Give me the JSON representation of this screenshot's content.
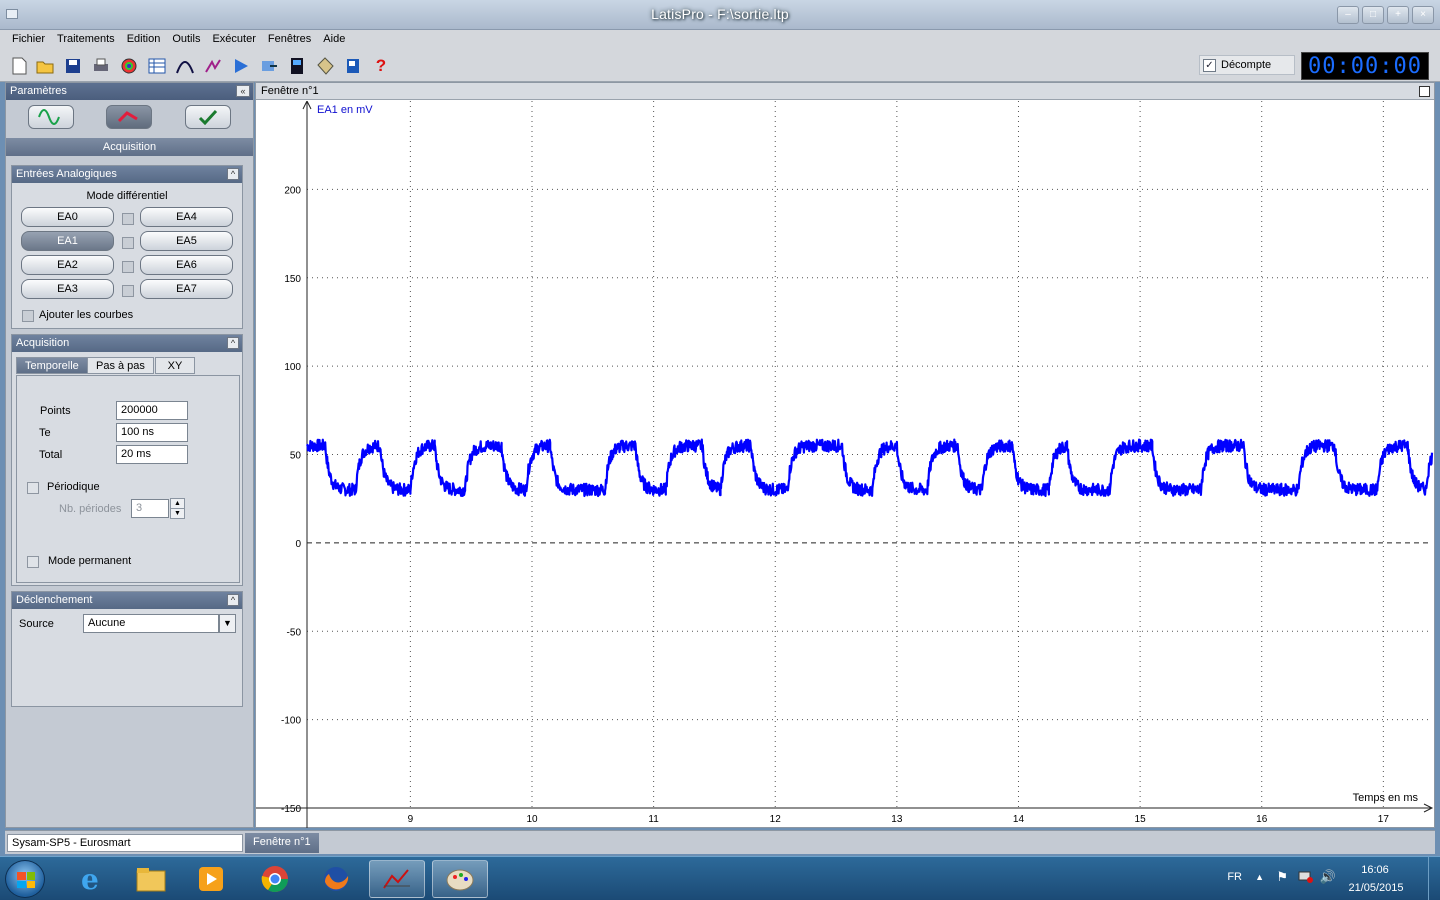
{
  "window": {
    "title": "LatisPro - F:\\sortie.ltp"
  },
  "menu": [
    "Fichier",
    "Traitements",
    "Edition",
    "Outils",
    "Exécuter",
    "Fenêtres",
    "Aide"
  ],
  "toolbar": {
    "icons": [
      "new-icon",
      "open-icon",
      "save-icon",
      "print-icon",
      "color-icon",
      "table-icon",
      "curve-icon",
      "modeling-icon",
      "play-icon",
      "export-icon",
      "device-icon",
      "tag-icon",
      "book-icon",
      "help-icon"
    ],
    "help_glyph": "?",
    "decompte_label": "Décompte",
    "decompte_checked": true,
    "timer": "00:00:00"
  },
  "params": {
    "header": "Paramètres",
    "collapse_glyph": "«",
    "section": "Acquisition",
    "entrees": {
      "title": "Entrées Analogiques",
      "mode": "Mode différentiel",
      "channels_left": [
        "EA0",
        "EA1",
        "EA2",
        "EA3"
      ],
      "channels_right": [
        "EA4",
        "EA5",
        "EA6",
        "EA7"
      ],
      "selected": "EA1",
      "add_curves": "Ajouter les courbes"
    },
    "acquisition": {
      "title": "Acquisition",
      "tabs": [
        "Temporelle",
        "Pas à pas",
        "XY"
      ],
      "points_label": "Points",
      "points_value": "200000",
      "te_label": "Te",
      "te_value": "100 ns",
      "total_label": "Total",
      "total_value": "20 ms",
      "periodique": "Périodique",
      "nb_periodes_label": "Nb. périodes",
      "nb_periodes_value": "3",
      "mode_permanent": "Mode permanent"
    },
    "declenchement": {
      "title": "Déclenchement",
      "source_label": "Source",
      "source_value": "Aucune"
    }
  },
  "graph": {
    "window_title": "Fenêtre n°1",
    "y_label": "EA1 en mV",
    "x_label": "Temps en ms"
  },
  "chart_data": {
    "type": "line",
    "series": [
      {
        "name": "EA1",
        "color": "#0000ff"
      }
    ],
    "x_range": [
      8.15,
      17.4
    ],
    "y_range": [
      -150,
      250
    ],
    "x_ticks": [
      9,
      10,
      11,
      12,
      13,
      14,
      15,
      16,
      17
    ],
    "y_ticks": [
      200,
      150,
      100,
      50,
      0,
      -50,
      -100,
      -150
    ],
    "signal": {
      "description_of_shape": "square-like wave alternating between about 55 mV and about 30 mV with exponential transitions",
      "high_mV": 55,
      "low_mV": 30,
      "segments": [
        [
          8.15,
          "H"
        ],
        [
          8.3,
          "L"
        ],
        [
          8.55,
          "H"
        ],
        [
          8.75,
          "L"
        ],
        [
          9.0,
          "H"
        ],
        [
          9.2,
          "L"
        ],
        [
          9.45,
          "H"
        ],
        [
          9.75,
          "L"
        ],
        [
          9.95,
          "H"
        ],
        [
          10.15,
          "L"
        ],
        [
          10.6,
          "H"
        ],
        [
          10.85,
          "L"
        ],
        [
          11.1,
          "H"
        ],
        [
          11.4,
          "L"
        ],
        [
          11.55,
          "H"
        ],
        [
          11.8,
          "L"
        ],
        [
          12.1,
          "H"
        ],
        [
          12.55,
          "L"
        ],
        [
          12.8,
          "H"
        ],
        [
          13.0,
          "L"
        ],
        [
          13.25,
          "H"
        ],
        [
          13.5,
          "L"
        ],
        [
          13.7,
          "H"
        ],
        [
          13.95,
          "L"
        ],
        [
          14.25,
          "H"
        ],
        [
          14.4,
          "L"
        ],
        [
          14.75,
          "H"
        ],
        [
          15.1,
          "L"
        ],
        [
          15.5,
          "H"
        ],
        [
          15.85,
          "L"
        ],
        [
          16.3,
          "H"
        ],
        [
          16.6,
          "L"
        ],
        [
          16.95,
          "H"
        ],
        [
          17.2,
          "L"
        ],
        [
          17.35,
          "H"
        ]
      ]
    },
    "grid": "dotted",
    "zero_line": "dashed"
  },
  "statusbar": {
    "device": "Sysam-SP5 - Eurosmart",
    "window_tab": "Fenêtre n°1"
  },
  "taskbar": {
    "apps": [
      "ie-icon",
      "explorer-icon",
      "media-player-icon",
      "chrome-icon",
      "firefox-icon",
      "latispro-icon",
      "paint-icon"
    ],
    "active_app": "latispro-icon",
    "language": "FR",
    "time": "16:06",
    "date": "21/05/2015"
  }
}
